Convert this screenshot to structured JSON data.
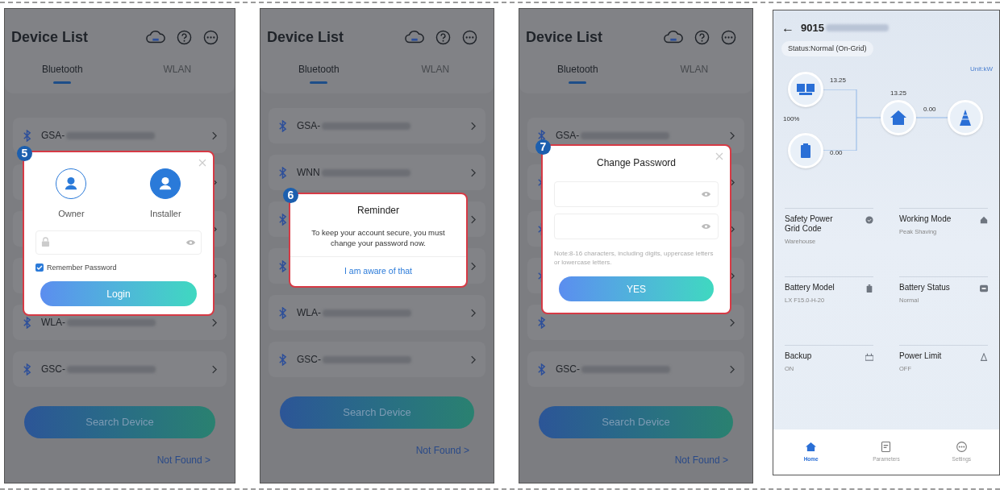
{
  "screens": [
    {
      "kind": "device_list",
      "title": "Device List",
      "tabs": [
        {
          "label": "Bluetooth",
          "selected": true
        },
        {
          "label": "WLAN",
          "selected": false
        }
      ],
      "devices": [
        {
          "kind": "named",
          "prefix": "GSA-"
        },
        {
          "kind": "hidden"
        },
        {
          "kind": "hidden"
        },
        {
          "kind": "hidden"
        },
        {
          "kind": "named",
          "prefix": "WLA-"
        },
        {
          "kind": "named",
          "prefix": "GSC-"
        }
      ],
      "search_button": "Search Device",
      "not_found": "Not Found >",
      "dialog": {
        "kind": "login",
        "step": "5",
        "roles": [
          {
            "label": "Owner",
            "selected": false
          },
          {
            "label": "Installer",
            "selected": true
          }
        ],
        "remember": {
          "label": "Remember Password",
          "checked": true
        },
        "button": "Login"
      }
    },
    {
      "kind": "device_list",
      "title": "Device List",
      "tabs": [
        {
          "label": "Bluetooth",
          "selected": true
        },
        {
          "label": "WLAN",
          "selected": false
        }
      ],
      "devices": [
        {
          "kind": "named",
          "prefix": "GSA-"
        },
        {
          "kind": "named",
          "prefix": "WNN"
        },
        {
          "kind": "hidden"
        },
        {
          "kind": "hidden"
        },
        {
          "kind": "named",
          "prefix": "WLA-"
        },
        {
          "kind": "named",
          "prefix": "GSC-"
        }
      ],
      "search_button": "Search Device",
      "not_found": "Not Found >",
      "dialog": {
        "kind": "reminder",
        "step": "6",
        "title": "Reminder",
        "message": "To keep your account secure, you must change your password  now.",
        "action": "I am aware of that"
      }
    },
    {
      "kind": "device_list",
      "title": "Device List",
      "tabs": [
        {
          "label": "Bluetooth",
          "selected": true
        },
        {
          "label": "WLAN",
          "selected": false
        }
      ],
      "devices": [
        {
          "kind": "named",
          "prefix": "GSA-"
        },
        {
          "kind": "hidden"
        },
        {
          "kind": "hidden"
        },
        {
          "kind": "hidden"
        },
        {
          "kind": "hidden"
        },
        {
          "kind": "named",
          "prefix": "GSC-"
        }
      ],
      "search_button": "Search Device",
      "not_found": "Not Found >",
      "dialog": {
        "kind": "change_password",
        "step": "7",
        "title": "Change Password",
        "note": "Note:8-16 characters, including digits, uppercase letters or lowercase letters.",
        "button": "YES"
      }
    },
    {
      "kind": "home",
      "back": "←",
      "device_prefix": "9015",
      "status": "Status:Normal (On-Grid)",
      "unit": "Unit:kW",
      "flow": {
        "pv": "13.25",
        "soc": "100%",
        "battery": "0.00",
        "load": "13.25",
        "grid": "0.00"
      },
      "cards": [
        {
          "title": "Safety Power Grid Code",
          "value": "Warehouse"
        },
        {
          "title": "Working Mode",
          "value": "Peak Shaving"
        },
        {
          "title": "Battery Model",
          "value": "LX F15.0-H-20"
        },
        {
          "title": "Battery Status",
          "value": "Normal"
        },
        {
          "title": "Backup",
          "value": "ON"
        },
        {
          "title": "Power Limit",
          "value": "OFF"
        }
      ],
      "nav": [
        {
          "label": "Home",
          "selected": true
        },
        {
          "label": "Parameters",
          "selected": false
        },
        {
          "label": "Settings",
          "selected": false
        }
      ]
    }
  ]
}
